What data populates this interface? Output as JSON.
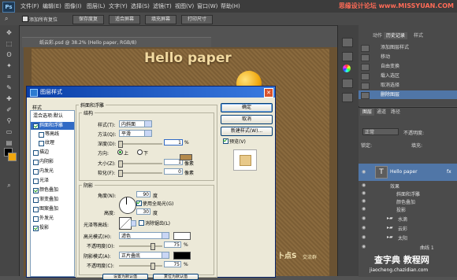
{
  "menubar": {
    "logo": "Ps",
    "items": [
      "文件(F)",
      "编辑(E)",
      "图像(I)",
      "图层(L)",
      "文字(Y)",
      "选择(S)",
      "滤镜(T)",
      "视图(V)",
      "窗口(W)",
      "帮助(H)"
    ],
    "watermark": "思缘设计论坛 www.MISSYUAN.COM",
    "watermark_small": " "
  },
  "optionsbar": {
    "checkbox_label": "添加所有复位",
    "buttons": [
      "保存度复",
      "适合屏幕",
      "填充屏幕",
      "打印尺寸"
    ]
  },
  "document": {
    "tab_title": "纸云彩.psd @ 38.2% (Hello paper, RGB/8)",
    "headline": "Hello paper",
    "corner_brand": "卜点S",
    "corner_sub": "交流群"
  },
  "history": {
    "tabs": [
      "动作",
      "历史记录",
      "样式"
    ],
    "items": [
      "添加图层样式",
      "移动",
      "自由变换",
      "载入选区",
      "取消选择",
      "删除图层"
    ],
    "selected_index": 5
  },
  "layers": {
    "tabs": [
      "图层",
      "通道",
      "路径"
    ],
    "mode": "正常",
    "opacity_label": "不透明度:",
    "lock_label": "锁定:",
    "fill_label": "填充:",
    "rows": [
      {
        "name": "Hello paper",
        "kind": "text",
        "fx": "fx"
      },
      {
        "name": "效果",
        "kind": "effect-header"
      },
      {
        "name": "斜面和浮雕",
        "kind": "effect"
      },
      {
        "name": "颜色叠加",
        "kind": "effect"
      },
      {
        "name": "投影",
        "kind": "effect"
      },
      {
        "name": "水滴",
        "kind": "group"
      },
      {
        "name": "云彩",
        "kind": "group"
      },
      {
        "name": "太阳",
        "kind": "group"
      },
      {
        "name": "曲线 1",
        "kind": "adjustment"
      }
    ]
  },
  "footer_watermark": {
    "line1": "查字典 教程网",
    "line2": "jiaocheng.chazidian.com"
  },
  "dialog": {
    "title": "图层样式",
    "styles_header": "样式",
    "blend_options": "混合选项:默认",
    "style_items": [
      {
        "label": "斜面和浮雕",
        "checked": true,
        "selected": true
      },
      {
        "label": "等高线",
        "checked": false,
        "indent": true
      },
      {
        "label": "纹理",
        "checked": false,
        "indent": true
      },
      {
        "label": "描边",
        "checked": false
      },
      {
        "label": "内阴影",
        "checked": false
      },
      {
        "label": "内发光",
        "checked": false
      },
      {
        "label": "光泽",
        "checked": false
      },
      {
        "label": "颜色叠加",
        "checked": true
      },
      {
        "label": "渐变叠加",
        "checked": false
      },
      {
        "label": "图案叠加",
        "checked": false
      },
      {
        "label": "外发光",
        "checked": false
      },
      {
        "label": "投影",
        "checked": true
      }
    ],
    "section_title": "斜面和浮雕",
    "structure": {
      "title": "结构",
      "style_label": "样式(T):",
      "style_value": "内斜面",
      "technique_label": "方法(Q):",
      "technique_value": "平滑",
      "depth_label": "深度(D):",
      "depth_value": "1",
      "depth_unit": "%",
      "direction_label": "方向:",
      "up_label": "上",
      "down_label": "下",
      "size_label": "大小(Z):",
      "size_value": "1",
      "size_unit": "像素",
      "soften_label": "软化(F):",
      "soften_value": "0",
      "soften_unit": "像素"
    },
    "shading": {
      "title": "阴影",
      "angle_label": "角度(N):",
      "angle_value": "90",
      "angle_unit": "度",
      "global_light_label": "使用全局光(G)",
      "altitude_label": "高度:",
      "altitude_value": "30",
      "altitude_unit": "度",
      "gloss_label": "光泽等高线:",
      "antialias_label": "消除锯齿(L)",
      "highlight_label": "高光模式(H):",
      "highlight_value": "滤色",
      "highlight_opacity_label": "不透明度(O):",
      "highlight_opacity": "75",
      "shadow_label": "阴影模式(A):",
      "shadow_value": "正片叠底",
      "shadow_opacity_label": "不透明度(C):",
      "shadow_opacity": "75",
      "percent": "%"
    },
    "buttons": {
      "ok": "确定",
      "cancel": "取消",
      "new_style": "新建样式(W)...",
      "preview": "预览(V)",
      "set_default": "设置为默认值",
      "reset_default": "复位为默认值"
    }
  },
  "colors": {
    "accent": "#316ac5",
    "title_bar": "#0a3fa8",
    "canvas_brown": "#8a6a3e",
    "coin": "#f0a70e"
  }
}
